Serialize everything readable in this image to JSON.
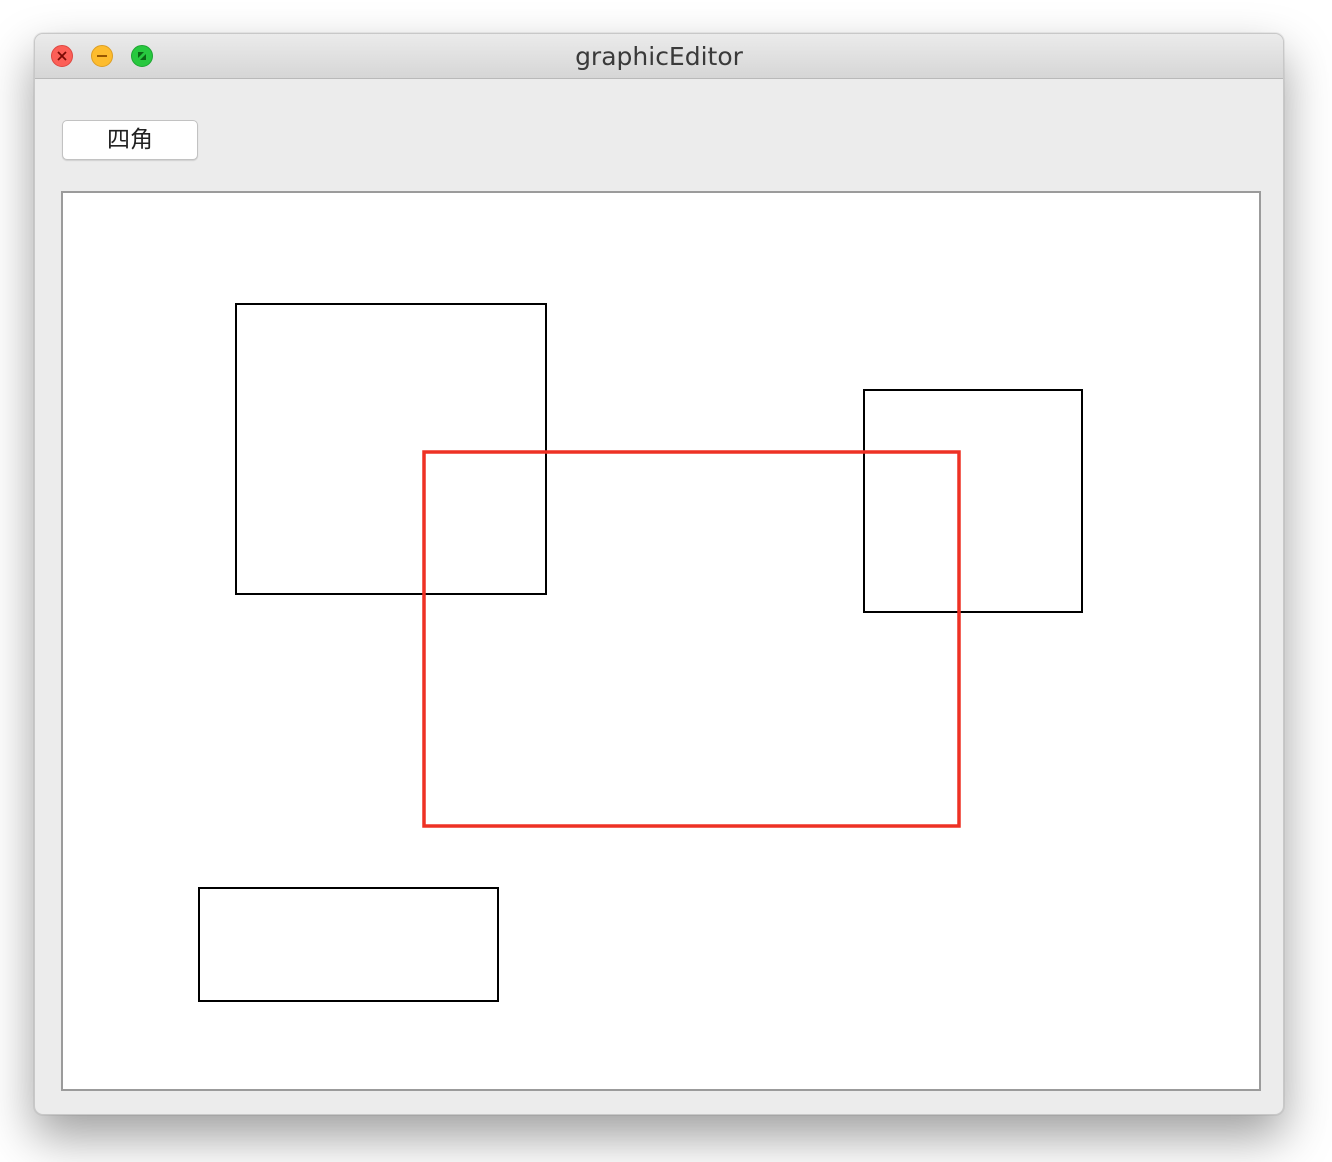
{
  "window": {
    "title": "graphicEditor",
    "controls": {
      "close": "close-icon",
      "minimize": "minimize-icon",
      "zoom": "zoom-icon"
    }
  },
  "toolbar": {
    "rect_button_label": "四角"
  },
  "colors": {
    "selected_stroke": "#ee3124",
    "normal_stroke": "#000000",
    "canvas_background": "#ffffff"
  },
  "canvas": {
    "shape_type": "rectangle",
    "shape_count": 4,
    "selected_index": 3
  }
}
